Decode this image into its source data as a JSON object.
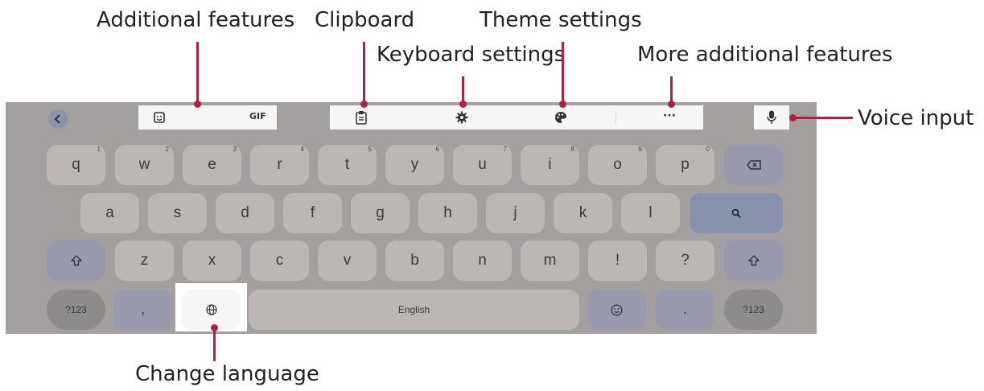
{
  "callouts": {
    "additional_features": "Additional features",
    "clipboard": "Clipboard",
    "keyboard_settings": "Keyboard settings",
    "theme_settings": "Theme settings",
    "more_additional_features": "More additional features",
    "voice_input": "Voice input",
    "change_language": "Change language"
  },
  "toolbar": {
    "back_icon": "chevron-left-icon",
    "gif_label": "GIF",
    "more_label": "···"
  },
  "keys": {
    "row1": [
      {
        "label": "q",
        "num": "1"
      },
      {
        "label": "w",
        "num": "2"
      },
      {
        "label": "e",
        "num": "3"
      },
      {
        "label": "r",
        "num": "4"
      },
      {
        "label": "t",
        "num": "5"
      },
      {
        "label": "y",
        "num": "6"
      },
      {
        "label": "u",
        "num": "7"
      },
      {
        "label": "i",
        "num": "8"
      },
      {
        "label": "o",
        "num": "9"
      },
      {
        "label": "p",
        "num": "0"
      }
    ],
    "row2": [
      "a",
      "s",
      "d",
      "f",
      "g",
      "h",
      "j",
      "k",
      "l"
    ],
    "row3": [
      "z",
      "x",
      "c",
      "v",
      "b",
      "n",
      "m",
      "!",
      "?"
    ],
    "row4": {
      "symbols_left": "?123",
      "comma": ",",
      "space": "English",
      "period": ".",
      "symbols_right": "?123"
    }
  },
  "colors": {
    "accent": "#b2203f",
    "keyboard_bg": "#a5a0a0",
    "key_bg": "#bcb6b5",
    "mod_key_bg": "#9a9aad"
  }
}
